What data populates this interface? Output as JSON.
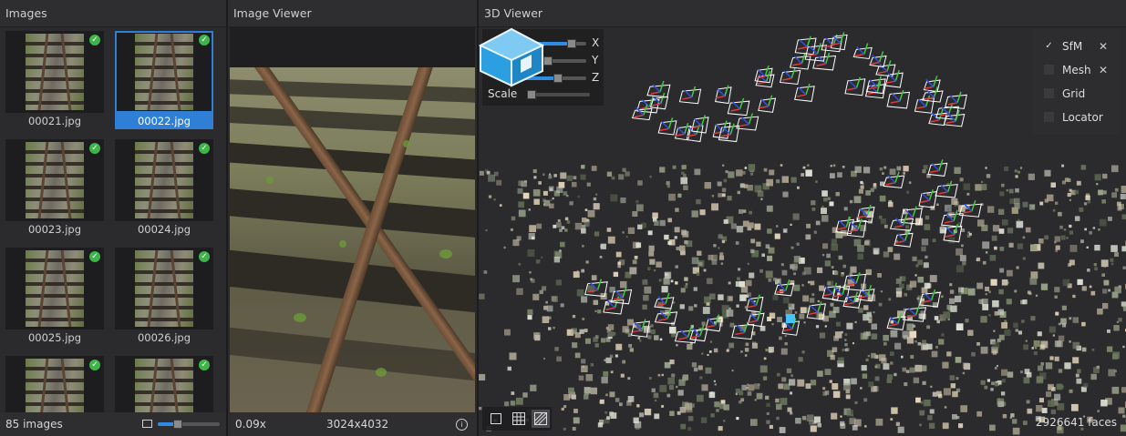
{
  "images_panel": {
    "title": "Images",
    "thumbnails": [
      {
        "name": "00021.jpg",
        "selected": false,
        "status": "reconstructed"
      },
      {
        "name": "00022.jpg",
        "selected": true,
        "status": "reconstructed"
      },
      {
        "name": "00023.jpg",
        "selected": false,
        "status": "reconstructed"
      },
      {
        "name": "00024.jpg",
        "selected": false,
        "status": "reconstructed"
      },
      {
        "name": "00025.jpg",
        "selected": false,
        "status": "reconstructed"
      },
      {
        "name": "00026.jpg",
        "selected": false,
        "status": "reconstructed"
      },
      {
        "name": "",
        "selected": false,
        "status": "reconstructed"
      },
      {
        "name": "",
        "selected": false,
        "status": "reconstructed"
      }
    ],
    "count_label": "85 images",
    "thumbnail_size_fraction": 0.33
  },
  "image_viewer": {
    "title": "Image Viewer",
    "zoom": "0.09x",
    "resolution": "3024x4032",
    "info_icon": "info-icon"
  },
  "viewer_3d": {
    "title": "3D Viewer",
    "trackball_icon": "3D",
    "axes": [
      {
        "label": "X",
        "value_fraction": 0.77
      },
      {
        "label": "Y",
        "value_fraction": 0.4
      },
      {
        "label": "Z",
        "value_fraction": 0.55
      }
    ],
    "scale_label": "Scale",
    "scale_fraction": 0.0,
    "layers": [
      {
        "name": "SfM",
        "checked": true,
        "check_glyph": "✓",
        "removable": true
      },
      {
        "name": "Mesh",
        "checked": false,
        "check_glyph": "",
        "removable": true
      },
      {
        "name": "Grid",
        "checked": false,
        "check_glyph": "",
        "removable": false
      },
      {
        "name": "Locator",
        "checked": false,
        "check_glyph": "",
        "removable": false
      }
    ],
    "remove_glyph": "✕",
    "faces_label": "2926641 faces"
  },
  "colors": {
    "accent": "#2f8ce6",
    "selection": "#2f7fd6",
    "check": "#3eb44a",
    "axis_x": "#e03a3a",
    "axis_y": "#3ecb3e",
    "axis_z": "#2f4fe6",
    "logo_blue": "#2b9fe0"
  }
}
